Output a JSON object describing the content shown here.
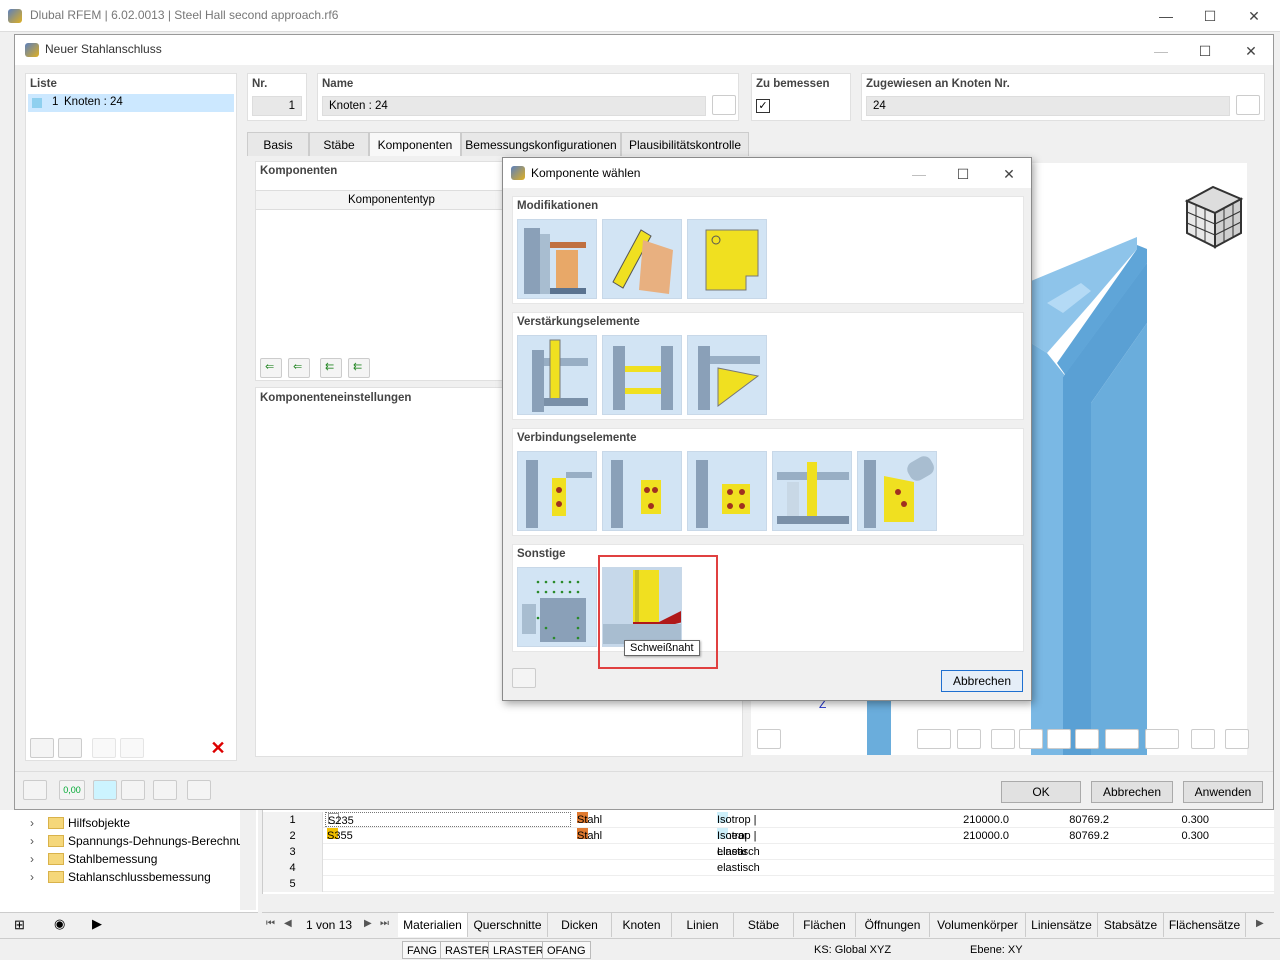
{
  "app": {
    "title": "Dlubal RFEM | 6.02.0013 | Steel Hall second approach.rf6"
  },
  "dialog": {
    "title": "Neuer Stahlanschluss",
    "list_label": "Liste",
    "list_items": [
      {
        "num": "1",
        "label": "Knoten : 24"
      }
    ],
    "nr_label": "Nr.",
    "nr_value": "1",
    "name_label": "Name",
    "name_value": "Knoten : 24",
    "design_label": "Zu bemessen",
    "assigned_label": "Zugewiesen an Knoten Nr.",
    "assigned_value": "24",
    "tabs": [
      "Basis",
      "Stäbe",
      "Komponenten",
      "Bemessungskonfigurationen",
      "Plausibilitätskontrolle"
    ],
    "active_tab": "Komponenten",
    "components_label": "Komponenten",
    "component_type_header": "Komponententyp",
    "component_settings_label": "Komponenteneinstellungen",
    "axis_z": "Z",
    "ok": "OK",
    "cancel": "Abbrechen",
    "apply": "Anwenden",
    "zero_value": "0,00"
  },
  "subdialog": {
    "title": "Komponente wählen",
    "sections": [
      "Modifikationen",
      "Verstärkungselemente",
      "Verbindungselemente",
      "Sonstige"
    ],
    "tooltip": "Schweißnaht",
    "cancel": "Abbrechen"
  },
  "tree": {
    "items": [
      "Hilfsobjekte",
      "Spannungs-Dehnungs-Berechnu",
      "Stahlbemessung",
      "Stahlanschlussbemessung"
    ]
  },
  "table": {
    "rows": [
      {
        "num": "1",
        "name": "S235",
        "type": "Stahl",
        "model": "Isotrop | Linear elastisch",
        "e": "210000.0",
        "g": "80769.2",
        "nu": "0.300"
      },
      {
        "num": "2",
        "name": "S355",
        "type": "Stahl",
        "model": "Isotrop | Linear elastisch",
        "e": "210000.0",
        "g": "80769.2",
        "nu": "0.300"
      },
      {
        "num": "3"
      },
      {
        "num": "4"
      },
      {
        "num": "5"
      }
    ],
    "pager": "1 von 13",
    "tabs": [
      "Materialien",
      "Querschnitte",
      "Dicken",
      "Knoten",
      "Linien",
      "Stäbe",
      "Flächen",
      "Öffnungen",
      "Volumenkörper",
      "Liniensätze",
      "Stabsätze",
      "Flächensätze"
    ]
  },
  "status": {
    "toggles": [
      "FANG",
      "RASTER",
      "LRASTER",
      "OFANG"
    ],
    "cs": "KS: Global XYZ",
    "plane": "Ebene: XY"
  },
  "colors": {
    "s235": "#ffffff",
    "s355": "#f2c000",
    "steel": "#e07a30",
    "isotrop": "#cdeffa",
    "member": "#6aaddc",
    "accent_red": "#e04040"
  }
}
